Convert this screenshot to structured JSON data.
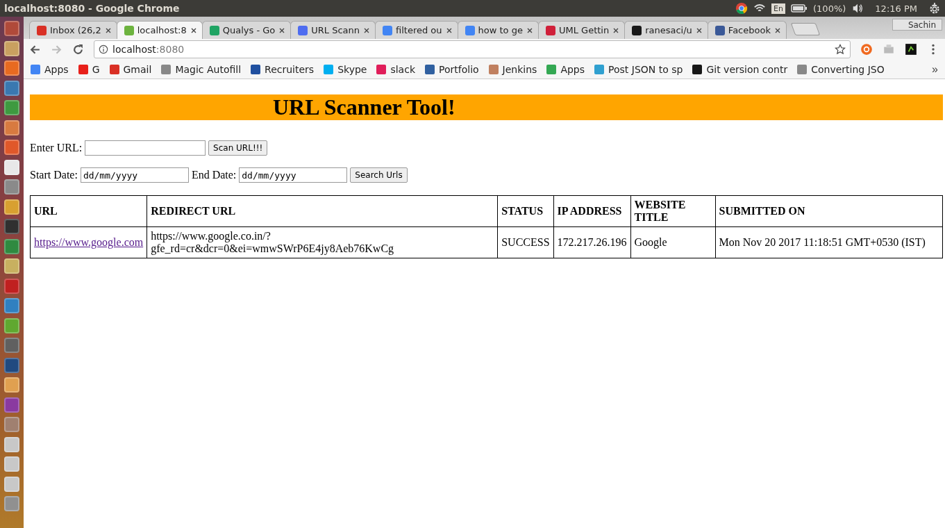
{
  "top_panel": {
    "title": "localhost:8080 - Google Chrome",
    "keyboard": "En",
    "battery": "(100%)",
    "clock": "12:16 PM"
  },
  "launcher": {
    "items": [
      {
        "color": "#b04a3a"
      },
      {
        "color": "#c9a060"
      },
      {
        "color": "#e86a20"
      },
      {
        "color": "#3a78b0"
      },
      {
        "color": "#3e9a40"
      },
      {
        "color": "#d87a40"
      },
      {
        "color": "#e0582a"
      },
      {
        "color": "#e8e8e8"
      },
      {
        "color": "#8a8a8a"
      },
      {
        "color": "#d8a030"
      },
      {
        "color": "#303030"
      },
      {
        "color": "#2f8a40"
      },
      {
        "color": "#c8b060"
      },
      {
        "color": "#c02020"
      },
      {
        "color": "#3080c0"
      },
      {
        "color": "#60a830"
      },
      {
        "color": "#606060"
      },
      {
        "color": "#204a80"
      },
      {
        "color": "#e0a050"
      },
      {
        "color": "#8a3aa0"
      },
      {
        "color": "#a08070"
      },
      {
        "color": "#c8c8c8"
      },
      {
        "color": "#c8c8c8"
      },
      {
        "color": "#c8c8c8"
      },
      {
        "color": "#909090"
      }
    ]
  },
  "tabs": [
    {
      "label": "Inbox (26,2",
      "selected": false,
      "color": "#d93025"
    },
    {
      "label": "localhost:8",
      "selected": true,
      "color": "#6db33f"
    },
    {
      "label": "Qualys - Go",
      "selected": false,
      "color": "#1fa463"
    },
    {
      "label": "URL Scann",
      "selected": false,
      "color": "#4e6cf0"
    },
    {
      "label": "filtered ou",
      "selected": false,
      "color": "#4285f4"
    },
    {
      "label": "how to ge",
      "selected": false,
      "color": "#4285f4"
    },
    {
      "label": "UML Gettin",
      "selected": false,
      "color": "#d0203a"
    },
    {
      "label": "ranesaci/u",
      "selected": false,
      "color": "#181818"
    },
    {
      "label": "Facebook",
      "selected": false,
      "color": "#3b5998"
    }
  ],
  "profile": "Sachin",
  "address_bar": {
    "host": "localhost",
    "port": ":8080"
  },
  "bookmarks": [
    {
      "label": "Apps",
      "color": "#4285f4"
    },
    {
      "label": "G",
      "color": "#e8201a"
    },
    {
      "label": "Gmail",
      "color": "#d93025"
    },
    {
      "label": "Magic Autofill",
      "color": "#888888"
    },
    {
      "label": "Recruiters",
      "color": "#2050a0"
    },
    {
      "label": "Skype",
      "color": "#00aff0"
    },
    {
      "label": "slack",
      "color": "#e01e5a"
    },
    {
      "label": "Portfolio",
      "color": "#3060a0"
    },
    {
      "label": "Jenkins",
      "color": "#c08060"
    },
    {
      "label": "Apps",
      "color": "#34a853"
    },
    {
      "label": "Post JSON to sp",
      "color": "#30a0d0"
    },
    {
      "label": "Git version contr",
      "color": "#181818"
    },
    {
      "label": "Converting JSO",
      "color": "#888888"
    }
  ],
  "bookmarks_more": "»",
  "page": {
    "heading": "URL Scanner Tool!",
    "url_form": {
      "label": "Enter URL:",
      "button": "Scan URL!!!"
    },
    "date_form": {
      "start_label": "Start Date:",
      "start_placeholder": "dd/mm/yyyy",
      "end_label": "End Date:",
      "end_placeholder": "dd/mm/yyyy",
      "button": "Search Urls"
    },
    "table": {
      "columns": [
        "URL",
        "REDIRECT URL",
        "STATUS",
        "IP ADDRESS",
        "WEBSITE TITLE",
        "SUBMITTED ON"
      ],
      "rows": [
        [
          "https://www.google.com",
          "https://www.google.co.in/?gfe_rd=cr&dcr=0&ei=wmwSWrP6E4jy8Aeb76KwCg",
          "SUCCESS",
          "172.217.26.196",
          "Google",
          "Mon Nov 20 2017 11:18:51 GMT+0530 (IST)"
        ]
      ]
    }
  }
}
